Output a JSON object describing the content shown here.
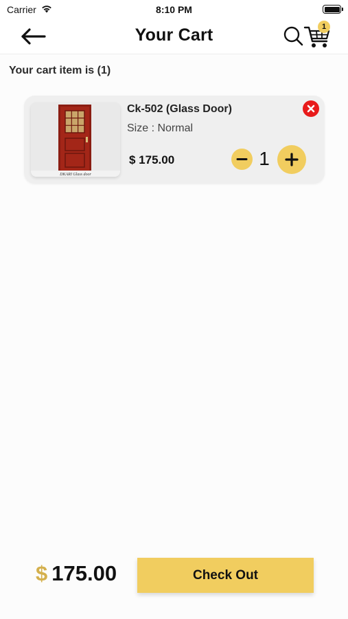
{
  "status_bar": {
    "carrier": "Carrier",
    "time": "8:10 PM"
  },
  "header": {
    "title": "Your Cart",
    "cart_badge_count": "1"
  },
  "cart": {
    "count_label": "Your cart item is (1)",
    "items": [
      {
        "name": "Ck-502 (Glass Door)",
        "size": "Size : Normal",
        "price": "$ 175.00",
        "quantity": "1",
        "image_caption": "DKARI Glass door"
      }
    ]
  },
  "footer": {
    "currency": "$",
    "total": "175.00",
    "checkout_label": "Check Out"
  },
  "colors": {
    "accent": "#f1cd5f",
    "remove": "#e81b1b",
    "currency_gold": "#d4b04d"
  },
  "icons": {
    "back": "arrow-left-icon",
    "search": "search-icon",
    "cart": "cart-icon",
    "remove": "close-icon",
    "decrement": "minus-icon",
    "increment": "plus-icon",
    "wifi": "wifi-icon",
    "battery": "battery-icon"
  }
}
